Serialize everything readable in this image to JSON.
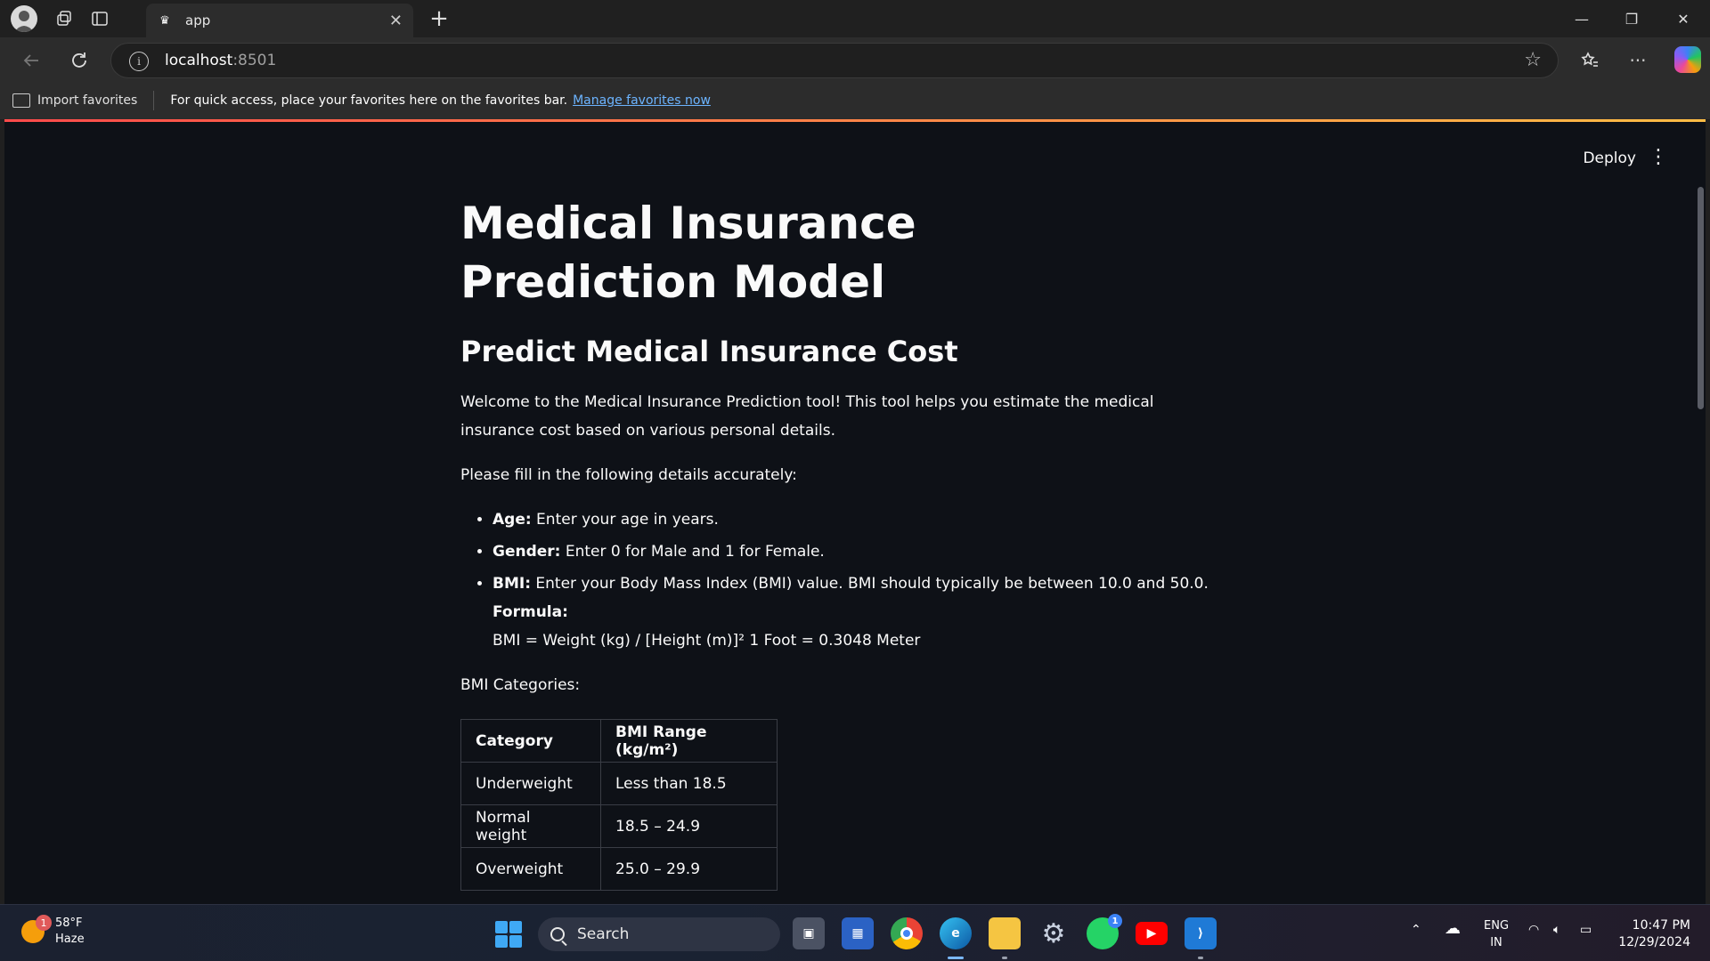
{
  "browser": {
    "tab_title": "app",
    "url_host": "localhost",
    "url_port": ":8501",
    "favorites_bar": {
      "import_label": "Import favorites",
      "message": "For quick access, place your favorites here on the favorites bar.",
      "link_label": "Manage favorites now"
    }
  },
  "app_toolbar": {
    "deploy_label": "Deploy"
  },
  "page": {
    "title": "Medical Insurance Prediction Model",
    "subtitle": "Predict Medical Insurance Cost",
    "intro": "Welcome to the Medical Insurance Prediction tool! This tool helps you estimate the medical insurance cost based on various personal details.",
    "instructions": "Please fill in the following details accurately:",
    "fields": [
      {
        "label": "Age:",
        "desc": " Enter your age in years."
      },
      {
        "label": "Gender:",
        "desc": " Enter 0 for Male and 1 for Female."
      },
      {
        "label": "BMI:",
        "desc": " Enter your Body Mass Index (BMI) value. BMI should typically be between 10.0 and 50.0."
      }
    ],
    "formula_label": "Formula:",
    "formula_text": "BMI = Weight (kg) / [Height (m)]² 1 Foot = 0.3048 Meter",
    "bmi_categories_label": "BMI Categories:",
    "bmi_table": {
      "headers": [
        "Category",
        "BMI Range (kg/m²)"
      ],
      "rows": [
        [
          "Underweight",
          "Less than 18.5"
        ],
        [
          "Normal weight",
          "18.5 – 24.9"
        ],
        [
          "Overweight",
          "25.0 – 29.9"
        ]
      ]
    }
  },
  "taskbar": {
    "weather_badge": "1",
    "temperature": "58°F",
    "condition": "Haze",
    "search_placeholder": "Search",
    "whatsapp_badge": "1",
    "lang_line1": "ENG",
    "lang_line2": "IN",
    "time": "10:47 PM",
    "date": "12/29/2024"
  }
}
